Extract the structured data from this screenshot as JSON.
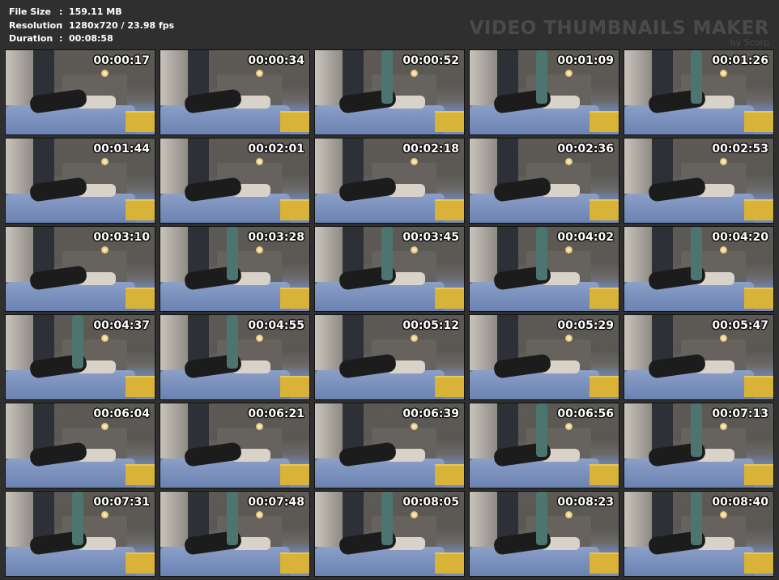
{
  "info": {
    "rows": [
      {
        "label": "File Size",
        "value": "159.11 MB"
      },
      {
        "label": "Resolution",
        "value": "1280x720 / 23.98 fps"
      },
      {
        "label": "Duration",
        "value": "00:08:58"
      }
    ]
  },
  "watermark": {
    "title": "VIDEO THUMBNAILS MAKER",
    "subtitle": "by Scorp"
  },
  "thumbnails": [
    "00:00:17",
    "00:00:34",
    "00:00:52",
    "00:01:09",
    "00:01:26",
    "00:01:44",
    "00:02:01",
    "00:02:18",
    "00:02:36",
    "00:02:53",
    "00:03:10",
    "00:03:28",
    "00:03:45",
    "00:04:02",
    "00:04:20",
    "00:04:37",
    "00:04:55",
    "00:05:12",
    "00:05:29",
    "00:05:47",
    "00:06:04",
    "00:06:21",
    "00:06:39",
    "00:06:56",
    "00:07:13",
    "00:07:31",
    "00:07:48",
    "00:08:05",
    "00:08:23",
    "00:08:40"
  ]
}
